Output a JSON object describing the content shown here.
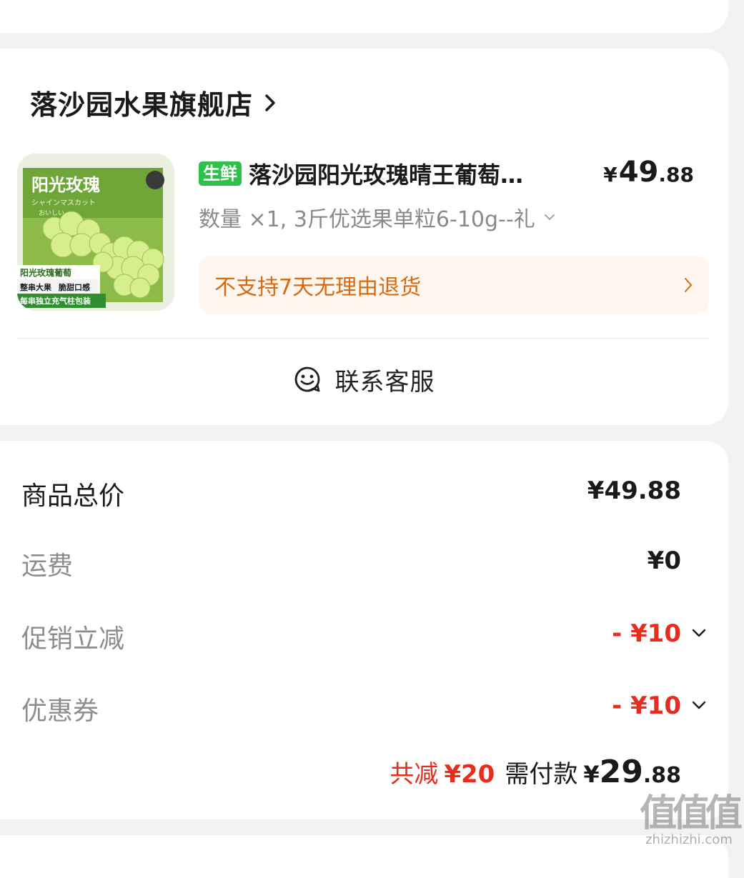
{
  "shop": {
    "name": "落沙园水果旗舰店"
  },
  "product": {
    "tag": "生鲜",
    "title": "落沙园阳光玫瑰晴王葡萄…",
    "price_yen": "¥",
    "price_int": "49",
    "price_dec": ".88",
    "spec": "数量 ×1, 3斤优选果单粒6-10g--礼",
    "return_policy": "不支持7天无理由退货",
    "image": {
      "title": "阳光玫瑰",
      "sub1": "シャインマスカット",
      "sub2": "おいしい",
      "label1": "阳光玫瑰葡萄",
      "label2": "整串大果",
      "label3": "脆甜口感",
      "label4": "每串独立充气柱包装"
    }
  },
  "service": {
    "label": "联系客服"
  },
  "price_details": {
    "rows": [
      {
        "label": "商品总价",
        "value": "¥49.88"
      },
      {
        "label": "运费",
        "value": "¥0"
      },
      {
        "label": "促销立减",
        "value": "- ¥10"
      },
      {
        "label": "优惠券",
        "value": "- ¥10"
      }
    ],
    "total_discount_label": "共减",
    "total_discount_value": "¥20",
    "pay_label": "需付款",
    "pay_yen": "¥",
    "pay_int": "29",
    "pay_dec": ".88"
  },
  "watermark": {
    "mark": "值值值",
    "url": "zhizhizhi.com"
  },
  "colors": {
    "accent_red": "#e62d1f",
    "fresh_tag": "#2fbf4a",
    "return_text": "#d56a12",
    "return_bg": "#fff7ef"
  }
}
